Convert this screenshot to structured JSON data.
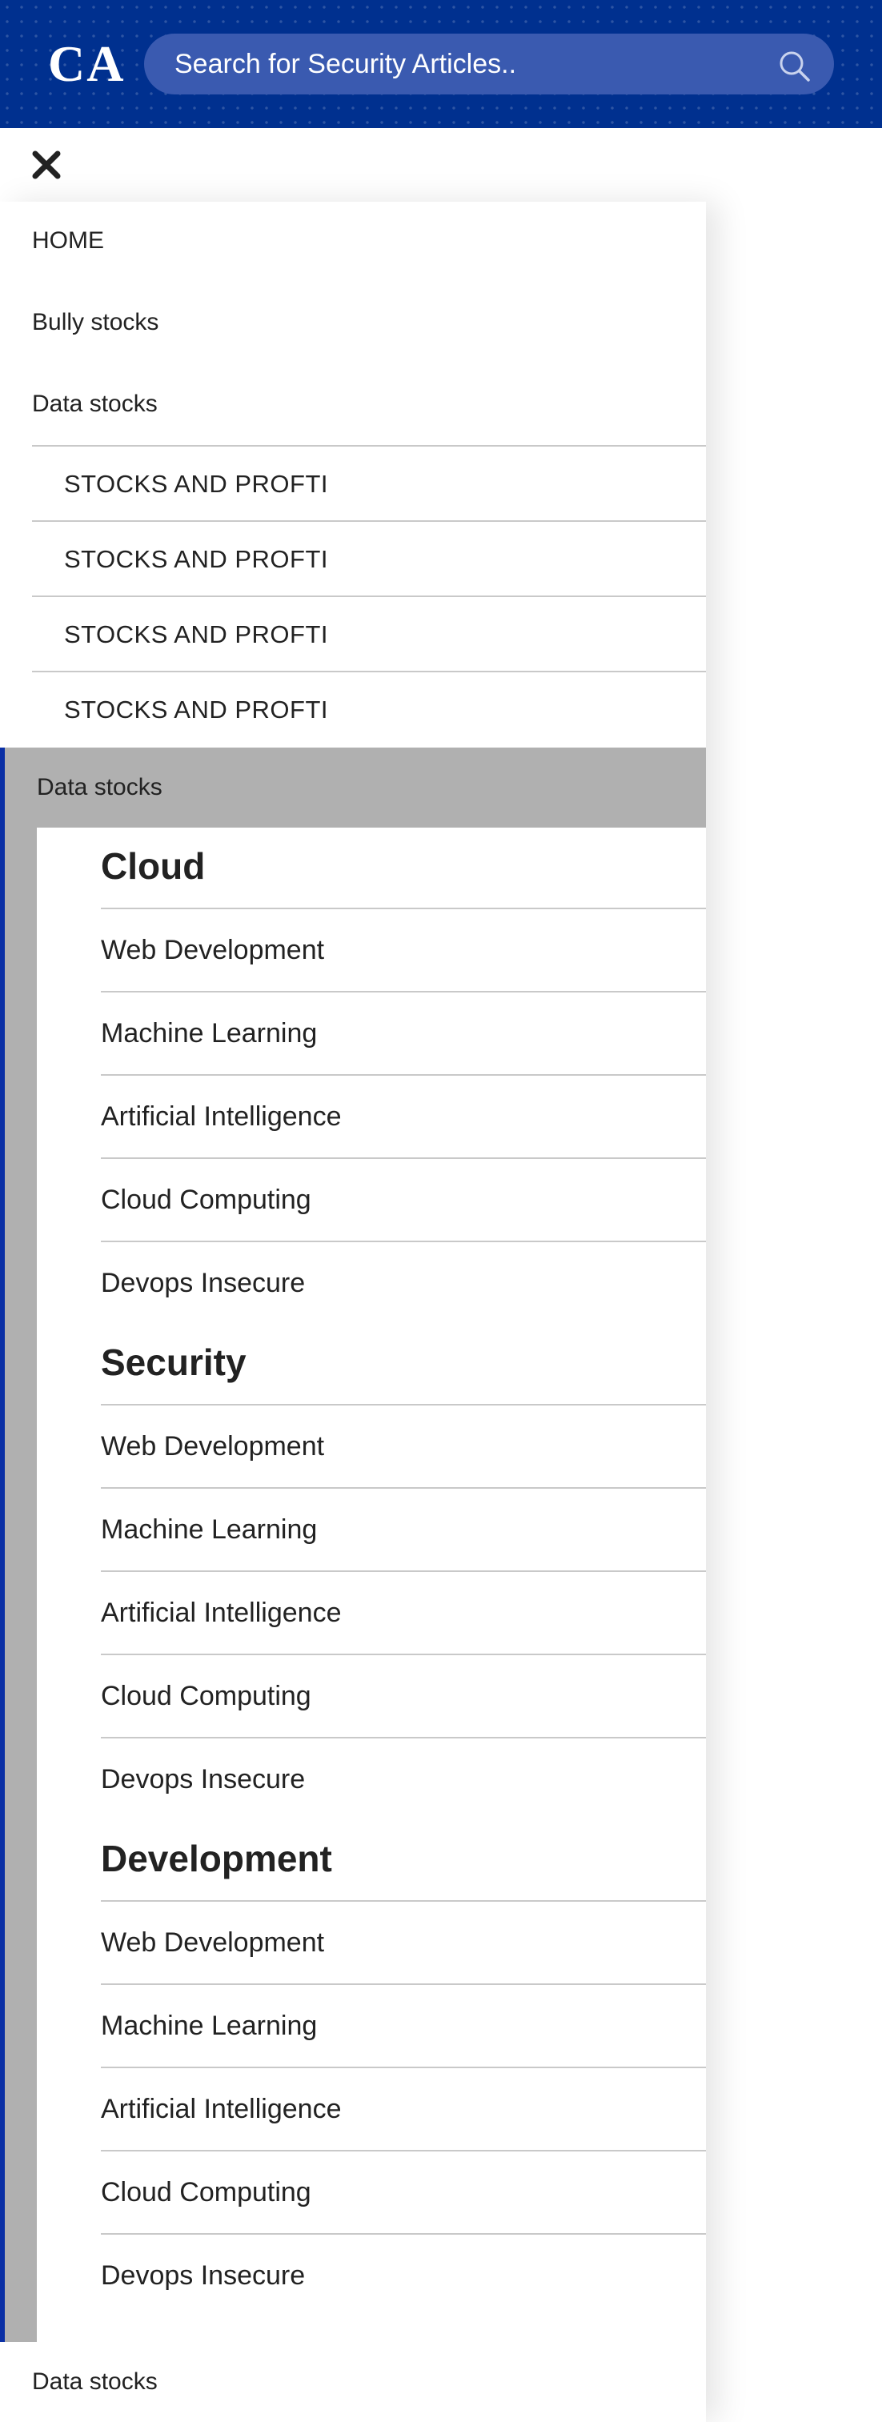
{
  "header": {
    "logo": "CA",
    "search_placeholder": "Search for Security Articles.."
  },
  "icons": {
    "close": "close-icon",
    "search": "search-icon"
  },
  "colors": {
    "header_bg": "#00308f",
    "accent_border": "#0a2fa5",
    "expanded_bg": "#b0b0b0"
  },
  "menu": {
    "top_items": [
      "HOME",
      "Bully stocks",
      "Data stocks"
    ],
    "sub_items": [
      "STOCKS AND PROFTI",
      "STOCKS AND PROFTI",
      "STOCKS AND PROFTI",
      "STOCKS AND PROFTI"
    ],
    "expanded": {
      "label": "Data stocks",
      "groups": [
        {
          "title": "Cloud",
          "links": [
            "Web Development",
            "Machine Learning",
            "Artificial Intelligence",
            "Cloud Computing",
            "Devops Insecure"
          ]
        },
        {
          "title": "Security",
          "links": [
            "Web Development",
            "Machine Learning",
            "Artificial Intelligence",
            "Cloud Computing",
            "Devops Insecure"
          ]
        },
        {
          "title": "Development",
          "links": [
            "Web Development",
            "Machine Learning",
            "Artificial Intelligence",
            "Cloud Computing",
            "Devops Insecure"
          ]
        }
      ]
    },
    "bottom_item": "Data stocks"
  }
}
